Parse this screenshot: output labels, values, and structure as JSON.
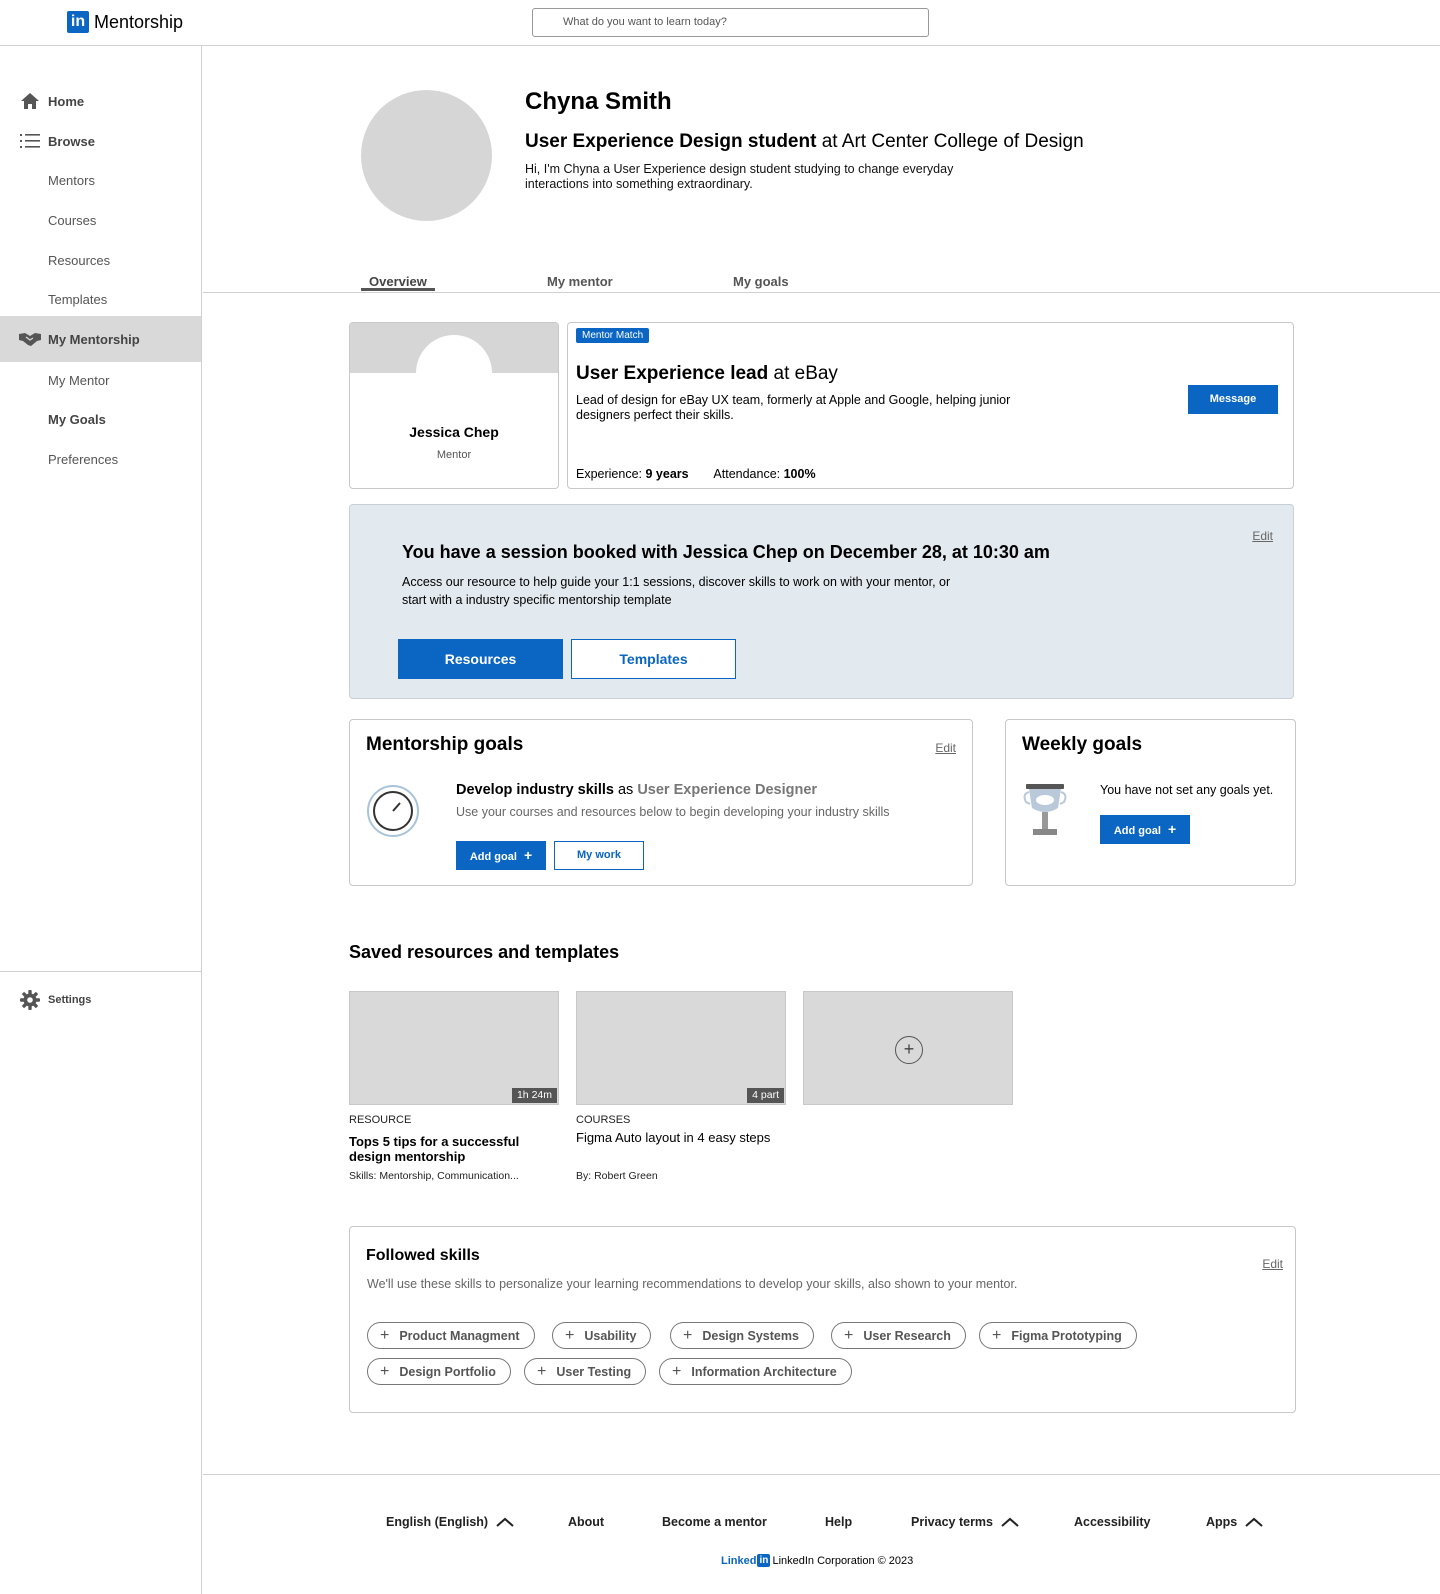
{
  "header": {
    "app_name": "Mentorship",
    "logo_letters": "in",
    "search_placeholder": "What do you want to learn today?"
  },
  "sidebar": {
    "items": [
      {
        "label": "Home",
        "icon": "home-icon"
      },
      {
        "label": "Browse",
        "icon": "list-icon"
      },
      {
        "label": "Mentors"
      },
      {
        "label": "Courses"
      },
      {
        "label": "Resources"
      },
      {
        "label": "Templates"
      },
      {
        "label": "My Mentorship",
        "icon": "handshake-icon",
        "active": true
      },
      {
        "label": "My Mentor"
      },
      {
        "label": "My Goals"
      },
      {
        "label": "Preferences"
      }
    ],
    "settings_label": "Settings"
  },
  "profile": {
    "name": "Chyna Smith",
    "title_role": "User Experience Design student",
    "title_rest": " at Art Center College of Design",
    "bio": "Hi, I'm Chyna a User Experience design student studying to change everyday interactions into something extraordinary."
  },
  "tabs": [
    {
      "label": "Overview",
      "active": true
    },
    {
      "label": "My mentor"
    },
    {
      "label": "My goals"
    }
  ],
  "mentor": {
    "name": "Jessica Chep",
    "role": "Mentor",
    "badge": "Mentor Match",
    "title_role": "User Experience lead",
    "title_rest": " at eBay",
    "description": "Lead of design for eBay UX team, formerly  at Apple and Google, helping junior designers perfect their skills.",
    "message_label": "Message",
    "experience_label": "Experience:",
    "experience_value": "9 years",
    "attendance_label": "Attendance:",
    "attendance_value": "100%"
  },
  "session": {
    "title": "You have a session booked with Jessica Chep on December 28, at 10:30 am",
    "description": "Access our resource to help guide your 1:1 sessions, discover skills to work on with your mentor, or start with a industry specific mentorship template",
    "edit_label": "Edit",
    "resources_label": "Resources",
    "templates_label": "Templates"
  },
  "mentorship_goals": {
    "heading": "Mentorship goals",
    "edit_label": "Edit",
    "goal_title": "Develop industry skills",
    "goal_as": " as ",
    "goal_role": "User Experience Designer",
    "goal_desc": "Use your courses and resources below to begin developing your industry skills",
    "add_goal_label": "Add goal",
    "my_work_label": "My work"
  },
  "weekly_goals": {
    "heading": "Weekly goals",
    "empty_text": "You have not set any goals yet.",
    "add_goal_label": "Add goal"
  },
  "saved": {
    "heading": "Saved resources and templates",
    "items": [
      {
        "kind": "RESOURCE",
        "title": "Tops 5 tips for a successful design mentorship",
        "meta": "Skills:  Mentorship, Communication...",
        "badge": "1h 24m"
      },
      {
        "kind": "COURSES",
        "title": "Figma Auto layout in 4 easy steps",
        "meta": "By: Robert Green",
        "badge": "4 part"
      }
    ],
    "add_symbol": "+"
  },
  "skills": {
    "heading": "Followed skills",
    "edit_label": "Edit",
    "description": "We'll use these skills to personalize your learning recommendations to develop your skills, also shown to your mentor.",
    "chips": [
      "Product Managment",
      "Usability",
      "Design Systems",
      "User Research",
      "Figma Prototyping",
      "Design Portfolio",
      "User Testing",
      "Information Architecture"
    ]
  },
  "footer": {
    "links": [
      "English (English)",
      "About",
      "Become a mentor",
      "Help",
      "Privacy terms",
      "Accessibility",
      "Apps"
    ],
    "brand_word": "Linked",
    "brand_box": "in",
    "copyright": "LinkedIn Corporation © 2023"
  },
  "colors": {
    "brand": "#0a66c2",
    "session_bg": "#e2e9ef",
    "placeholder": "#d6d6d6"
  }
}
